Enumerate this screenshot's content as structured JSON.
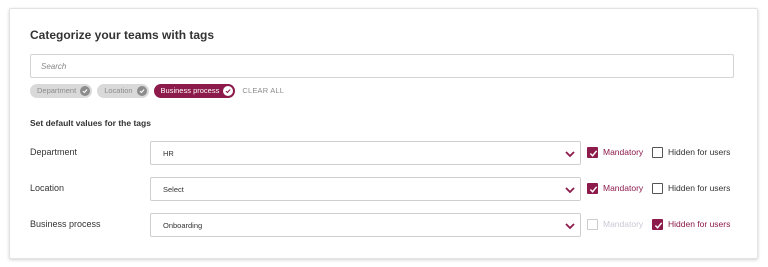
{
  "title": "Categorize your teams with tags",
  "search": {
    "placeholder": "Search",
    "value": ""
  },
  "chips": [
    {
      "label": "Department",
      "active": false
    },
    {
      "label": "Location",
      "active": false
    },
    {
      "label": "Business process",
      "active": true
    }
  ],
  "clear_all": "CLEAR ALL",
  "subtitle": "Set default values for the tags",
  "rows": [
    {
      "label": "Department",
      "value": "HR",
      "mandatory": {
        "label": "Mandatory",
        "checked": true,
        "disabled": false
      },
      "hidden": {
        "label": "Hidden for users",
        "checked": false
      }
    },
    {
      "label": "Location",
      "value": "Select",
      "mandatory": {
        "label": "Mandatory",
        "checked": true,
        "disabled": false
      },
      "hidden": {
        "label": "Hidden for users",
        "checked": false
      }
    },
    {
      "label": "Business process",
      "value": "Onboarding",
      "mandatory": {
        "label": "Mandatory",
        "checked": false,
        "disabled": true
      },
      "hidden": {
        "label": "Hidden for users",
        "checked": true
      }
    }
  ],
  "icons": {
    "chip_check": "check-circle-icon",
    "dropdown": "chevron-down-icon",
    "checkbox": "checkmark-icon"
  },
  "colors": {
    "accent": "#8c1a4a",
    "chip_inactive": "#d9d9d9",
    "text": "#333333",
    "disabled_text": "#c9c9d6"
  }
}
